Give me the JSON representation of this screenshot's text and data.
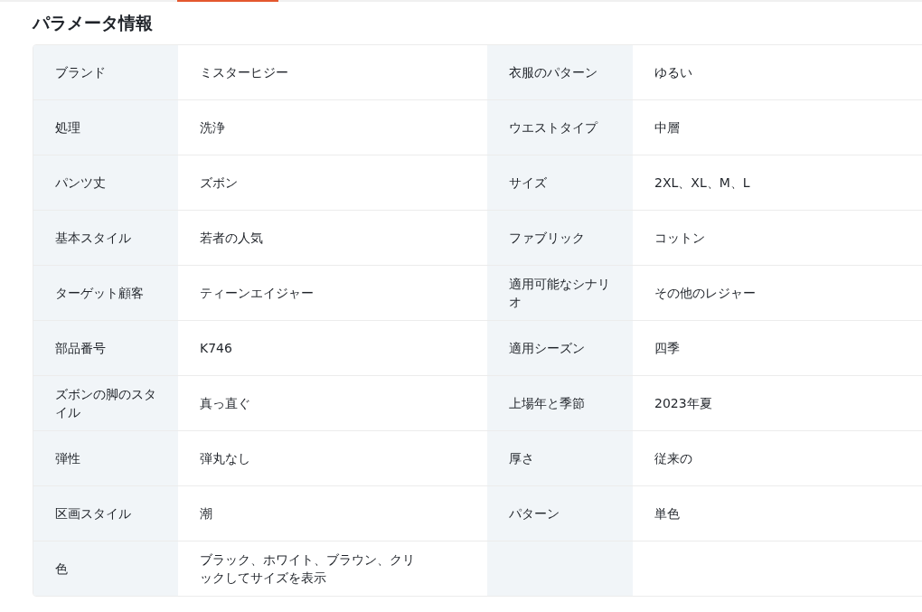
{
  "title": "パラメータ情報",
  "rows": [
    {
      "cells": [
        {
          "label": "ブランド",
          "value": "ミスターヒジー"
        },
        {
          "label": "衣服のパターン",
          "value": "ゆるい"
        }
      ]
    },
    {
      "cells": [
        {
          "label": "処理",
          "value": "洗浄"
        },
        {
          "label": "ウエストタイプ",
          "value": "中層"
        }
      ]
    },
    {
      "cells": [
        {
          "label": "パンツ丈",
          "value": "ズボン"
        },
        {
          "label": "サイズ",
          "value": "2XL、XL、M、L"
        }
      ]
    },
    {
      "cells": [
        {
          "label": "基本スタイル",
          "value": "若者の人気"
        },
        {
          "label": "ファブリック",
          "value": "コットン"
        }
      ]
    },
    {
      "cells": [
        {
          "label": "ターゲット顧客",
          "value": "ティーンエイジャー"
        },
        {
          "label": "適用可能なシナリオ",
          "value": "その他のレジャー"
        }
      ]
    },
    {
      "cells": [
        {
          "label": "部品番号",
          "value": "K746"
        },
        {
          "label": "適用シーズン",
          "value": "四季"
        }
      ]
    },
    {
      "cells": [
        {
          "label": "ズボンの脚のスタイル",
          "value": "真っ直ぐ"
        },
        {
          "label": "上場年と季節",
          "value": "2023年夏"
        }
      ]
    },
    {
      "cells": [
        {
          "label": "弾性",
          "value": "弾丸なし"
        },
        {
          "label": "厚さ",
          "value": "従来の"
        }
      ]
    },
    {
      "cells": [
        {
          "label": "区画スタイル",
          "value": "潮"
        },
        {
          "label": "パターン",
          "value": "単色"
        }
      ]
    },
    {
      "cells": [
        {
          "label": "色",
          "value": "ブラック、ホワイト、ブラウン、クリックしてサイズを表示"
        }
      ]
    }
  ]
}
